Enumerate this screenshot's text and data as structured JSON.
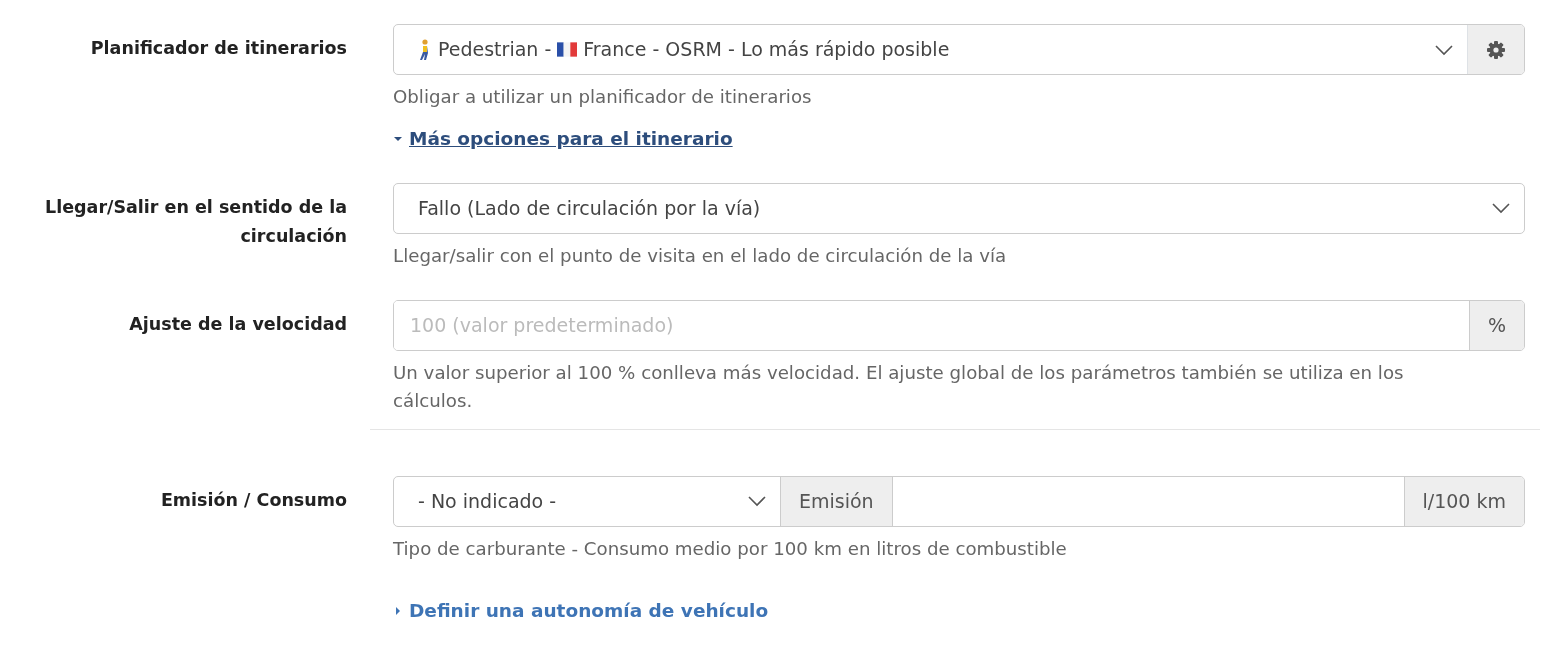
{
  "sections": [
    {
      "label": "Planificador de itinerarios",
      "control": {
        "kind": "select_button",
        "parts": [
          "Pedestrian -",
          "France - OSRM - Lo más rápido posible"
        ]
      },
      "help": "Obligar a utilizar un planificador de itinerarios",
      "toggle": {
        "label": "Más opciones para el itinerario",
        "expanded": true
      }
    },
    {
      "label": "Llegar/Salir en el sentido de la circulación",
      "control": {
        "kind": "select",
        "value": "Fallo (Lado de circulación por la vía)"
      },
      "help": "Llegar/salir con el punto de visita en el lado de circulación de la vía"
    },
    {
      "label": "Ajuste de la velocidad",
      "control": {
        "kind": "input_addon",
        "placeholder": "100 (valor predeterminado)",
        "addon": "%"
      },
      "help": "Un valor superior al 100 % conlleva más velocidad. El ajuste global de los parámetros también se utiliza en los cálculos.",
      "divider": true
    },
    {
      "label": "Emisión / Consumo",
      "control": {
        "kind": "select_input",
        "value": "- No indicado -",
        "prefix": "Emisión",
        "suffix": "l/100 km"
      },
      "help": "Tipo de carburante - Consumo medio por 100 km en litros de combustible",
      "toggle": {
        "label": "Definir una autonomía de vehículo",
        "expanded": false
      }
    }
  ]
}
